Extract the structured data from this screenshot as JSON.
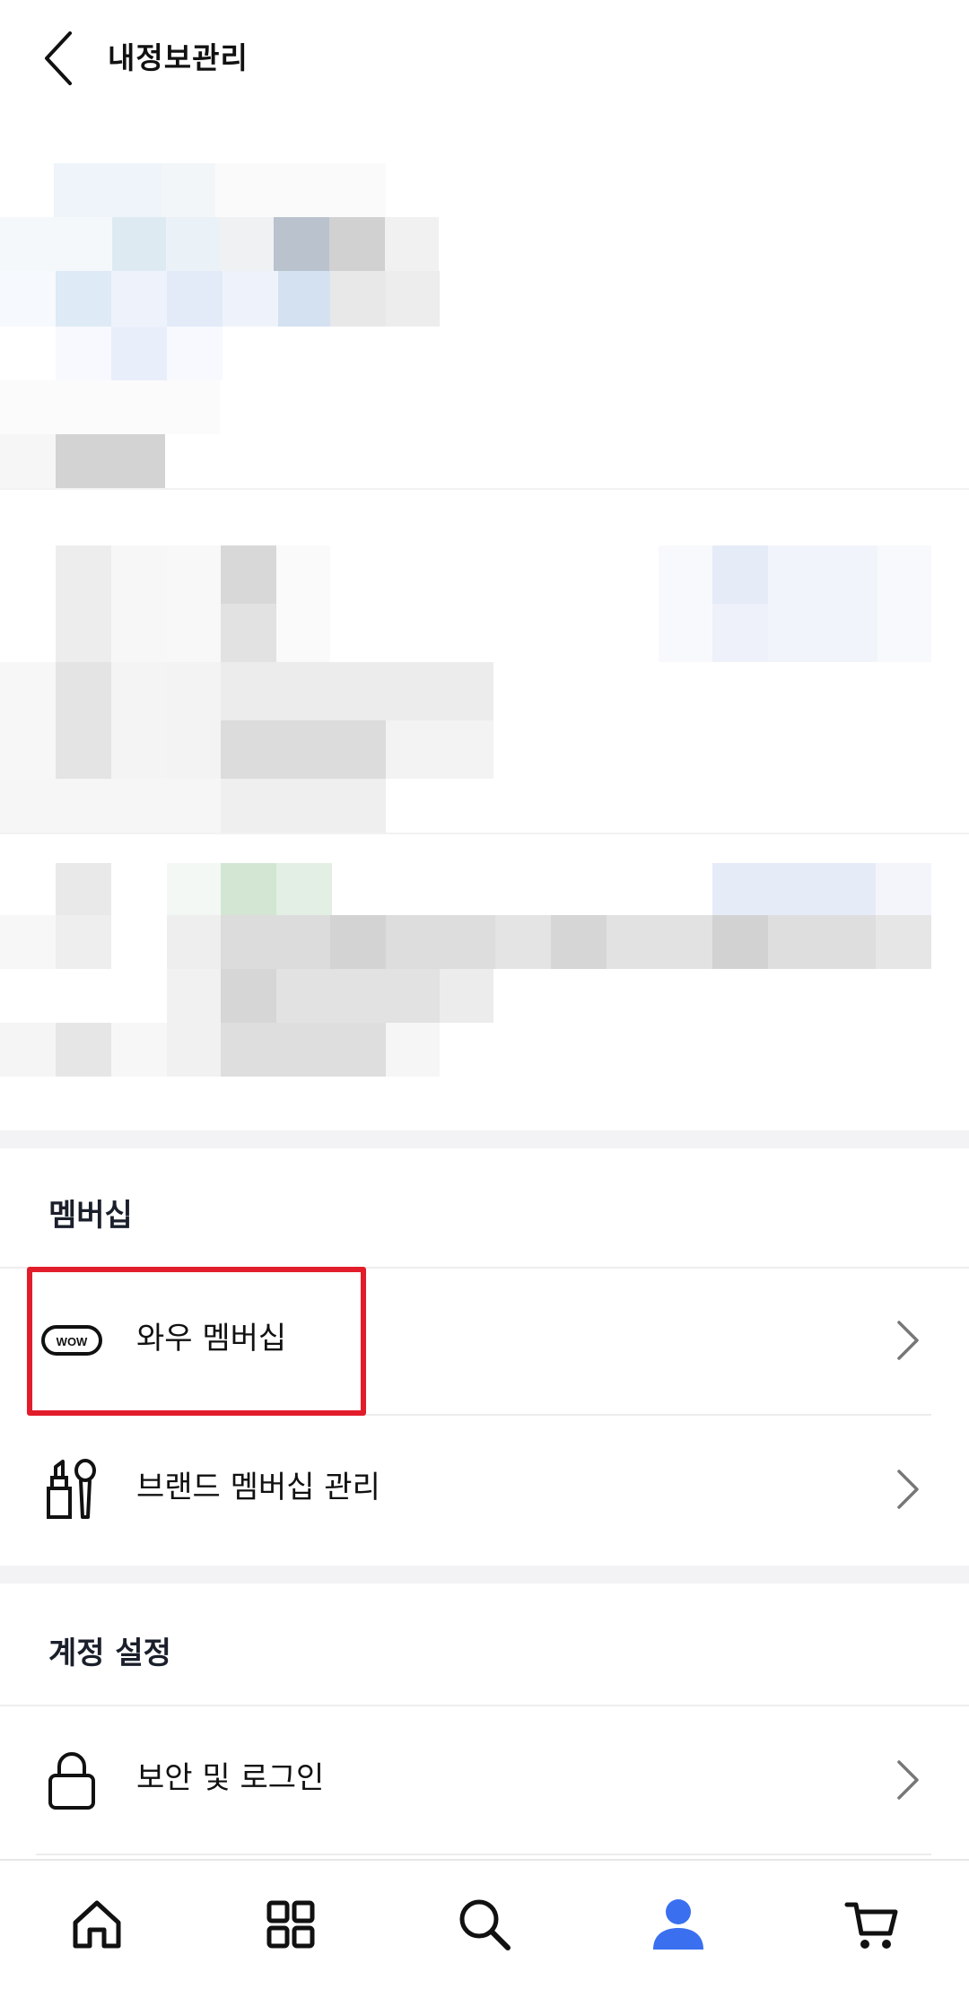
{
  "header": {
    "title": "내정보관리",
    "back_icon": "chevron-left-icon"
  },
  "membership": {
    "section_title": "멤버십",
    "items": [
      {
        "label": "와우 멤버십",
        "icon": "wow-badge-icon",
        "icon_text": "WOW"
      },
      {
        "label": "브랜드 멤버십 관리",
        "icon": "cosmetics-icon"
      }
    ]
  },
  "account": {
    "section_title": "계정 설정",
    "items": [
      {
        "label": "보안 및 로그인",
        "icon": "lock-icon"
      }
    ]
  },
  "bottom_nav": {
    "items": [
      {
        "icon": "home-icon",
        "active": false
      },
      {
        "icon": "category-grid-icon",
        "active": false
      },
      {
        "icon": "search-icon",
        "active": false
      },
      {
        "icon": "my-profile-icon",
        "active": true
      },
      {
        "icon": "cart-icon",
        "active": false
      }
    ]
  },
  "colors": {
    "active": "#3a6ff0",
    "highlight_border": "#e21d2b",
    "text": "#111111",
    "divider": "#f3f3f5"
  }
}
